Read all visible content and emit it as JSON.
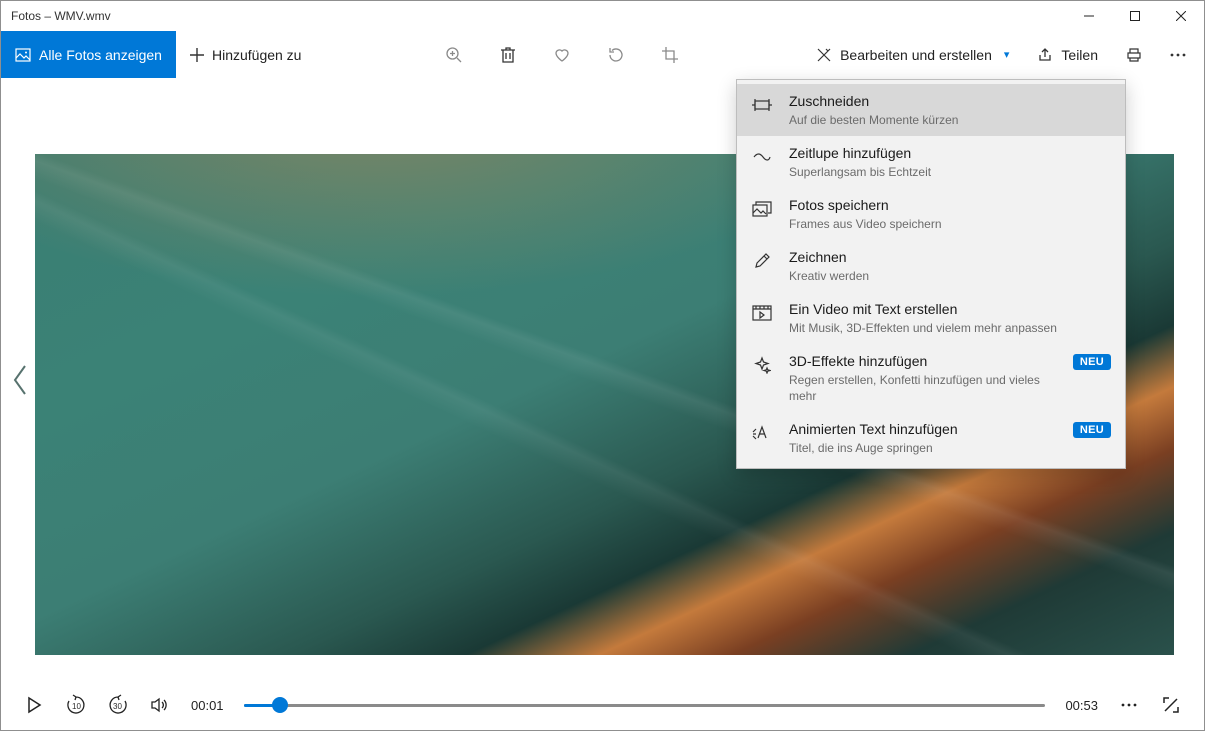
{
  "window": {
    "title": "Fotos – WMV.wmv"
  },
  "toolbar": {
    "all_photos": "Alle Fotos anzeigen",
    "add_to": "Hinzufügen zu",
    "edit_create": "Bearbeiten und erstellen",
    "share": "Teilen"
  },
  "menu": {
    "items": [
      {
        "title": "Zuschneiden",
        "subtitle": "Auf die besten Momente kürzen"
      },
      {
        "title": "Zeitlupe hinzufügen",
        "subtitle": "Superlangsam bis Echtzeit"
      },
      {
        "title": "Fotos speichern",
        "subtitle": "Frames aus Video speichern"
      },
      {
        "title": "Zeichnen",
        "subtitle": "Kreativ werden"
      },
      {
        "title": "Ein Video mit Text erstellen",
        "subtitle": "Mit Musik, 3D-Effekten und vielem mehr anpassen"
      },
      {
        "title": "3D-Effekte hinzufügen",
        "subtitle": "Regen erstellen, Konfetti hinzufügen und vieles mehr",
        "badge": "NEU"
      },
      {
        "title": "Animierten Text hinzufügen",
        "subtitle": "Titel, die ins Auge springen",
        "badge": "NEU"
      }
    ]
  },
  "playback": {
    "current": "00:01",
    "total": "00:53",
    "progress_pct": 4.5,
    "skip_back": "10",
    "skip_fwd": "30"
  }
}
